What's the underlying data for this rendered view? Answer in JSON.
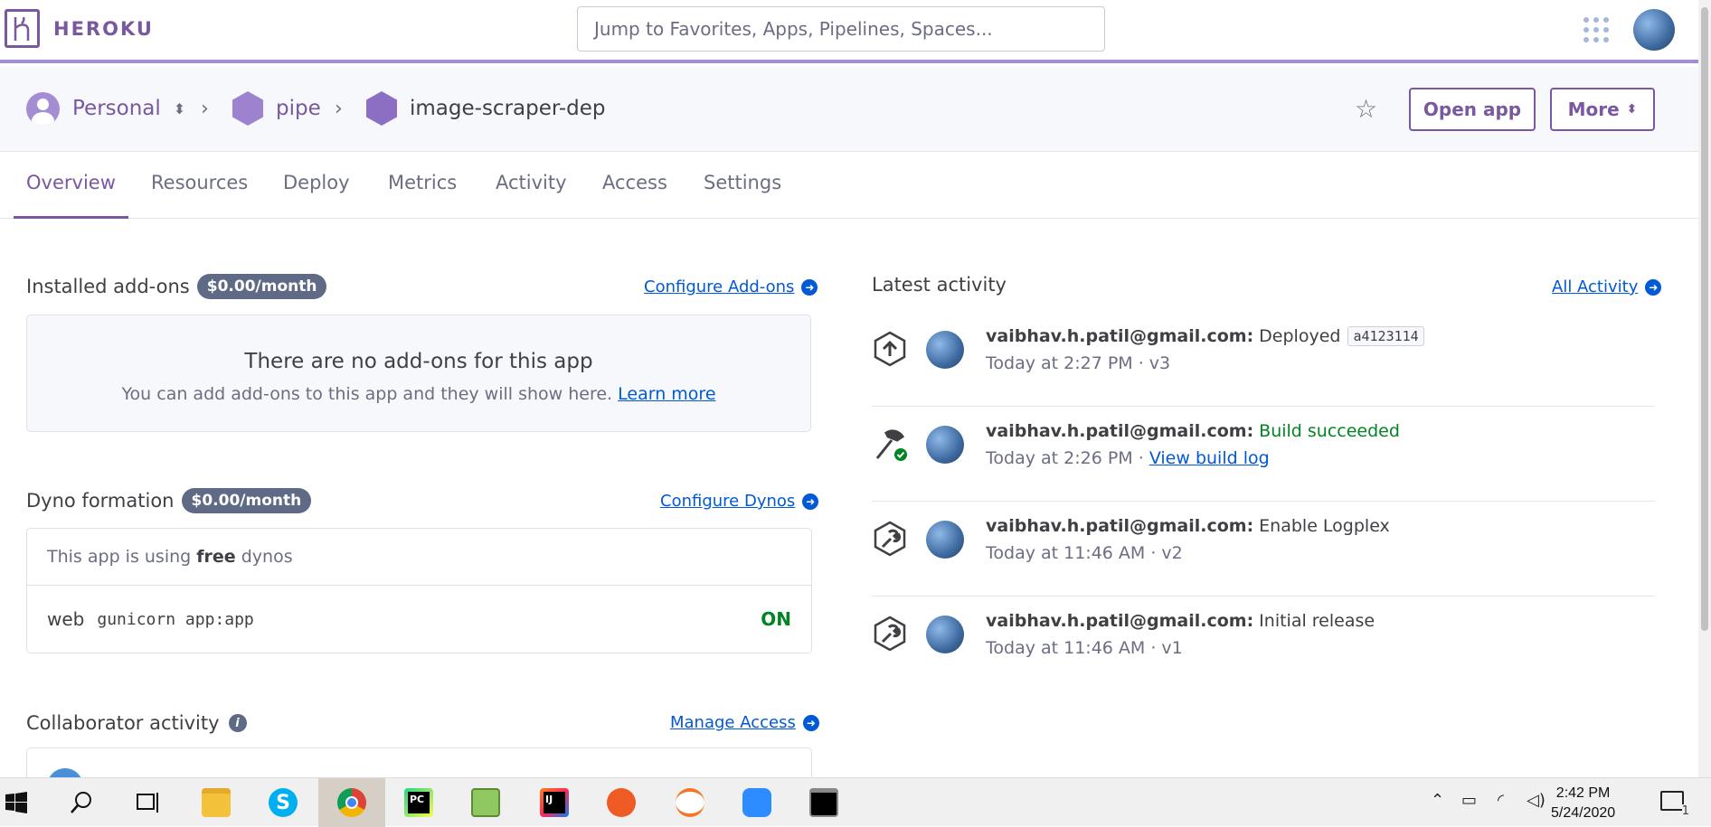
{
  "brand": {
    "name": "HEROKU",
    "color": "#79589f"
  },
  "search": {
    "placeholder": "Jump to Favorites, Apps, Pipelines, Spaces..."
  },
  "breadcrumb": {
    "personal": "Personal",
    "pipeline": "pipe",
    "app": "image-scraper-dep"
  },
  "header_buttons": {
    "open_app": "Open app",
    "more": "More"
  },
  "tabs": [
    "Overview",
    "Resources",
    "Deploy",
    "Metrics",
    "Activity",
    "Access",
    "Settings"
  ],
  "addons": {
    "title": "Installed add-ons",
    "cost": "$0.00/month",
    "configure": "Configure Add-ons",
    "empty_title": "There are no add-ons for this app",
    "empty_text": "You can add add-ons to this app and they will show here.",
    "learn_more": "Learn more"
  },
  "dynos": {
    "title": "Dyno formation",
    "cost": "$0.00/month",
    "configure": "Configure Dynos",
    "using_prefix": "This app is using",
    "using_type": "free",
    "using_suffix": "dynos",
    "process_type": "web",
    "command": "gunicorn app:app",
    "status": "ON"
  },
  "collaborators": {
    "title": "Collaborator activity",
    "manage": "Manage Access"
  },
  "activity": {
    "title": "Latest activity",
    "all": "All Activity",
    "items": [
      {
        "user": "vaibhav.h.patil@gmail.com:",
        "action": "Deployed",
        "commit": "a4123114",
        "time": "Today at 2:27 PM · v3",
        "icon": "deploy-icon"
      },
      {
        "user": "vaibhav.h.patil@gmail.com:",
        "action": "Build succeeded",
        "time": "Today at 2:26 PM ·",
        "link": "View build log",
        "icon": "build-icon"
      },
      {
        "user": "vaibhav.h.patil@gmail.com:",
        "action": "Enable Logplex",
        "time": "Today at 11:46 AM · v2",
        "icon": "wrench-icon"
      },
      {
        "user": "vaibhav.h.patil@gmail.com:",
        "action": "Initial release",
        "time": "Today at 11:46 AM · v1",
        "icon": "wrench-icon"
      }
    ]
  },
  "taskbar": {
    "time": "2:42 PM",
    "date": "5/24/2020",
    "notifications": "1"
  }
}
